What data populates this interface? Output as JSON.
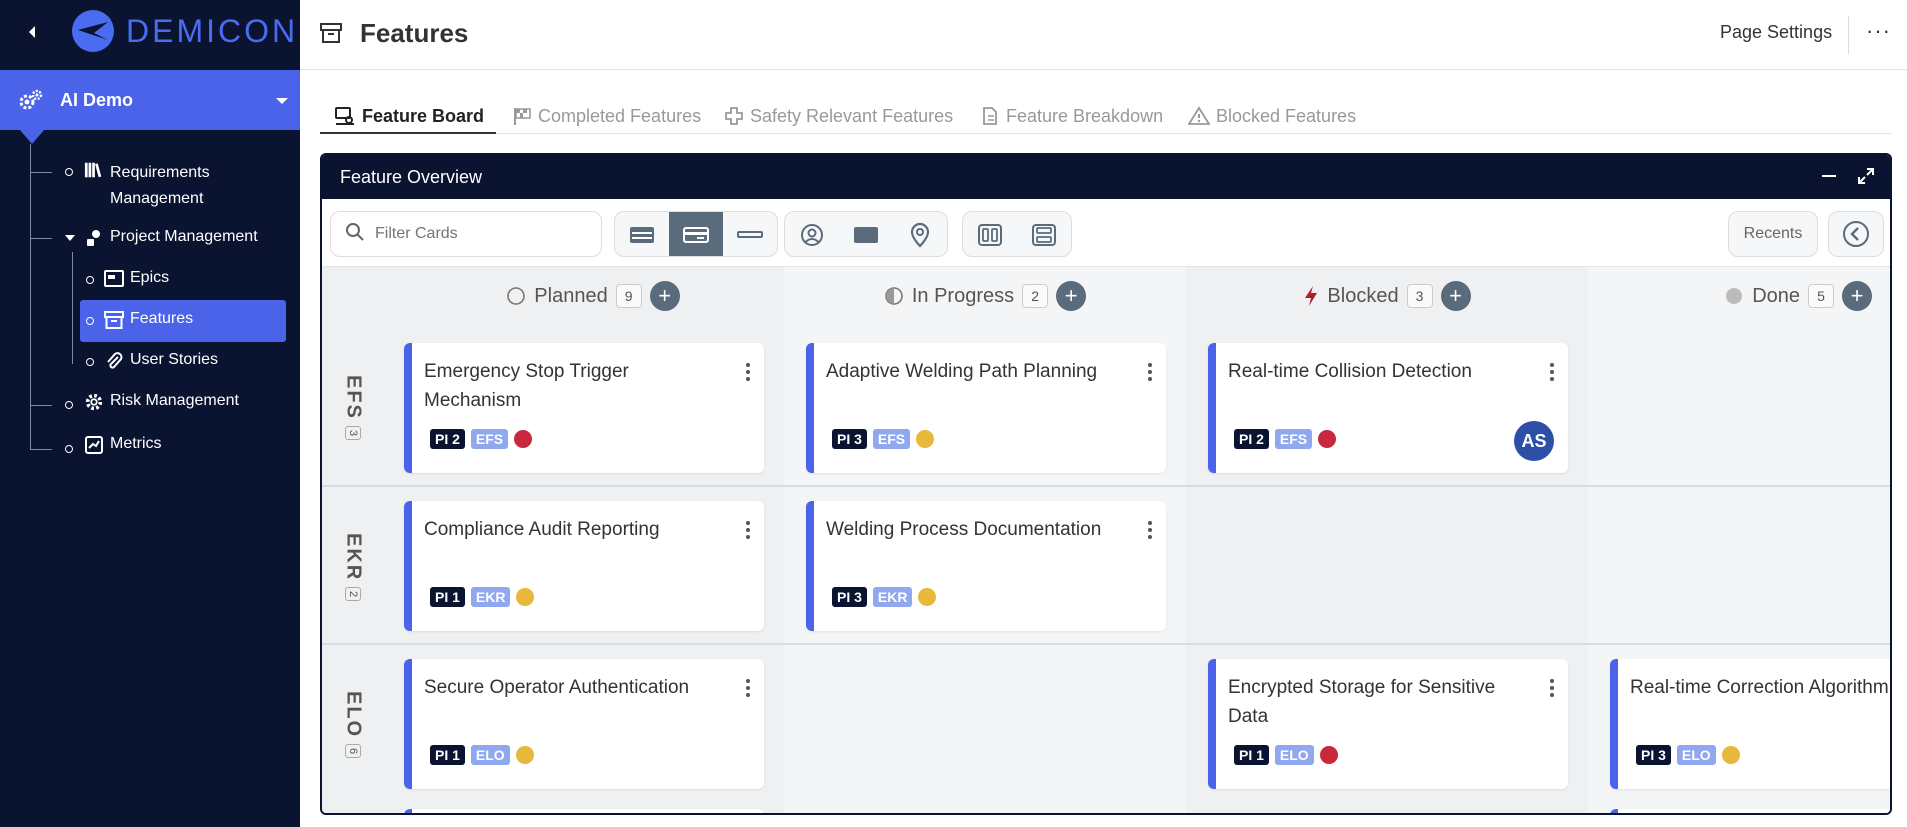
{
  "brand": {
    "logo_text": "DEMICON"
  },
  "project": {
    "name": "AI Demo"
  },
  "nav": {
    "requirements": "Requirements Management",
    "project_management": "Project Management",
    "epics": "Epics",
    "features": "Features",
    "user_stories": "User Stories",
    "risk_management": "Risk Management",
    "metrics": "Metrics"
  },
  "header": {
    "title": "Features",
    "page_settings": "Page Settings",
    "more": "···"
  },
  "tabs": [
    {
      "label": "Feature Board"
    },
    {
      "label": "Completed Features"
    },
    {
      "label": "Safety Relevant Features"
    },
    {
      "label": "Feature Breakdown"
    },
    {
      "label": "Blocked Features"
    }
  ],
  "panel": {
    "title": "Feature Overview"
  },
  "toolbar": {
    "search_placeholder": "Filter Cards",
    "recents": "Recents"
  },
  "columns": [
    {
      "name": "Planned",
      "count": "9"
    },
    {
      "name": "In Progress",
      "count": "2"
    },
    {
      "name": "Blocked",
      "count": "3"
    },
    {
      "name": "Done",
      "count": "5"
    }
  ],
  "swimlanes": [
    {
      "code": "EFS",
      "count": "3"
    },
    {
      "code": "EKR",
      "count": "2"
    },
    {
      "code": "ELO",
      "count": "6"
    }
  ],
  "cards": [
    {
      "title": "Emergency Stop Trigger Mechanism",
      "pi": "PI 2",
      "code": "EFS",
      "status_color": "#c8283c"
    },
    {
      "title": "Adaptive Welding Path Planning",
      "pi": "PI 3",
      "code": "EFS",
      "status_color": "#e8b83a"
    },
    {
      "title": "Real-time Collision Detection",
      "pi": "PI 2",
      "code": "EFS",
      "status_color": "#c8283c",
      "assignee": "AS"
    },
    {
      "title": "Compliance Audit Reporting",
      "pi": "PI 1",
      "code": "EKR",
      "status_color": "#e8b83a"
    },
    {
      "title": "Welding Process Documentation",
      "pi": "PI 3",
      "code": "EKR",
      "status_color": "#e8b83a"
    },
    {
      "title": "Secure Operator Authentication",
      "pi": "PI 1",
      "code": "ELO",
      "status_color": "#e8b83a"
    },
    {
      "title": "Encrypted Storage for Sensitive Data",
      "pi": "PI 1",
      "code": "ELO",
      "status_color": "#c8283c"
    },
    {
      "title": "Real-time Correction Algorithm",
      "pi": "PI 3",
      "code": "ELO",
      "status_color": "#e8b83a"
    }
  ],
  "colors": {
    "sidebar": "#0a1330",
    "accent": "#4a63e8",
    "tag_code": "#8fa8f0",
    "red": "#c8283c",
    "yellow": "#e8b83a"
  }
}
